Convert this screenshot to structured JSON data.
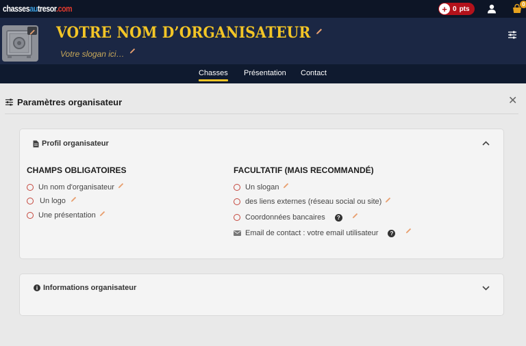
{
  "topbar": {
    "logo_part1": "chasses",
    "logo_part2": "au",
    "logo_part3": "tresor",
    "logo_part4": ".com",
    "points_value": "0",
    "points_unit": "pts",
    "cart_count": "0"
  },
  "hero": {
    "title": "VOTRE NOM D’ORGANISATEUR",
    "slogan": "Votre slogan ici…"
  },
  "nav": {
    "items": [
      "Chasses",
      "Présentation",
      "Contact"
    ],
    "active": "Chasses"
  },
  "panel": {
    "title": "Paramètres organisateur",
    "profile_card": {
      "title": "Profil organisateur",
      "required_heading": "CHAMPS OBLIGATOIRES",
      "required_items": [
        "Un nom d'organisateur",
        "Un logo",
        "Une présentation"
      ],
      "optional_heading": "FACULTATIF (MAIS RECOMMANDÉ)",
      "optional_items": [
        "Un slogan",
        "des liens externes (réseau social ou site)",
        "Coordonnées bancaires",
        "Email de contact : votre email utilisateur"
      ]
    },
    "info_card": {
      "title": "Informations organisateur"
    }
  },
  "colors": {
    "accent_gold": "#f3c526",
    "navy": "#1b2744",
    "pencil": "#e8a070",
    "required_circle": "#c4453b"
  }
}
